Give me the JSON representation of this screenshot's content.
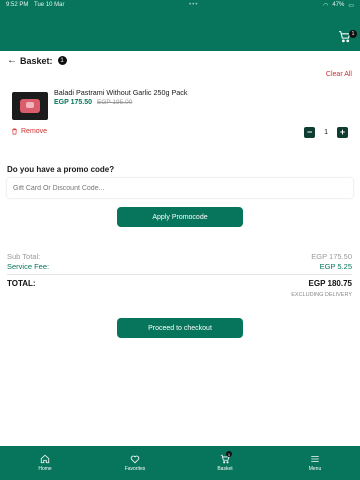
{
  "status_bar": {
    "time": "9:52 PM",
    "date": "Tue 10 Mar",
    "battery": "47%"
  },
  "header": {
    "cart_count": "1"
  },
  "basket": {
    "title": "Basket:",
    "count": "1",
    "clear_all": "Clear All"
  },
  "items": [
    {
      "name": "Baladi Pastrami Without Garlic 250g Pack",
      "price": "EGP 175.50",
      "old_price": "EGP 195.00",
      "remove_label": "Remove",
      "quantity": "1"
    }
  ],
  "promo": {
    "question": "Do you have a promo code?",
    "placeholder": "Gift Card Or Discount Code...",
    "apply_label": "Apply Promocode"
  },
  "summary": {
    "subtotal_label": "Sub Total:",
    "subtotal_value": "EGP 175.50",
    "service_label": "Service Fee:",
    "service_value": "EGP 5.25",
    "total_label": "TOTAL:",
    "total_value": "EGP 180.75",
    "note": "EXCLUDING DELIVERY"
  },
  "checkout_label": "Proceed to checkout",
  "nav": {
    "home": "Home",
    "favorites": "Favorites",
    "basket": "Basket",
    "basket_count": "1",
    "menu": "Menu"
  },
  "colors": {
    "primary": "#06755b",
    "danger": "#d32f2f",
    "dark_button": "#0f3d31"
  }
}
